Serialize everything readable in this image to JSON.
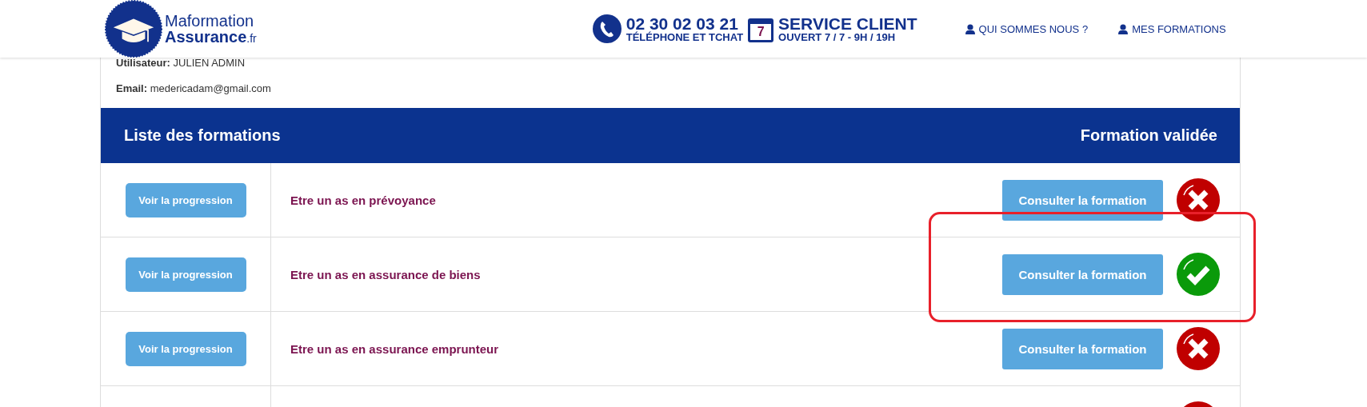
{
  "header": {
    "logo": {
      "line_1": "Maformation",
      "line_2": "Assurance",
      "suffix": ".fr"
    },
    "phone": {
      "number": "02 30 02 03 21",
      "caption": "TÉLÉPHONE ET TCHAT"
    },
    "service": {
      "calendar_day": "7",
      "title": "SERVICE CLIENT",
      "hours": "OUVERT 7 / 7 - 9H / 19H"
    },
    "nav": [
      {
        "label": "QUI SOMMES NOUS ?"
      },
      {
        "label": "MES FORMATIONS"
      }
    ]
  },
  "account": {
    "user_label": "Utilisateur:",
    "user_value": "JULIEN ADMIN",
    "email_label": "Email:",
    "email_value": "medericadam@gmail.com"
  },
  "table": {
    "title": "Liste des formations",
    "status_heading": "Formation validée",
    "rows": [
      {
        "progress_button": "Voir la progression",
        "name": "Etre un as en prévoyance",
        "open_button": "Consulter la formation",
        "validated": false,
        "highlighted": false
      },
      {
        "progress_button": "Voir la progression",
        "name": "Etre un as en assurance de biens",
        "open_button": "Consulter la formation",
        "validated": true,
        "highlighted": true
      },
      {
        "progress_button": "Voir la progression",
        "name": "Etre un as en assurance emprunteur",
        "open_button": "Consulter la formation",
        "validated": false,
        "highlighted": false
      },
      {
        "validated": false,
        "highlighted": false
      }
    ]
  }
}
